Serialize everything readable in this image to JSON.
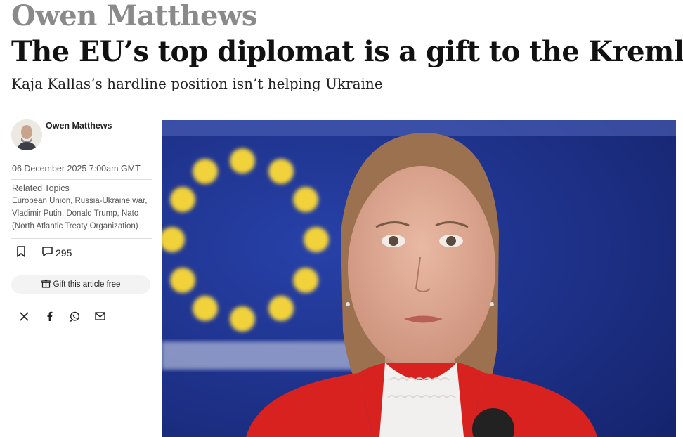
{
  "article": {
    "kicker": "Owen Matthews",
    "headline": "The EU’s top diplomat is a gift to the Kremlin",
    "standfirst": "Kaja Kallas’s hardline position isn’t helping Ukraine"
  },
  "sidebar": {
    "author_name": "Owen Matthews",
    "date": "06 December 2025 7:00am GMT",
    "related_topics_title": "Related Topics",
    "related_topics": "European Union, Russia-Ukraine war, Vladimir Putin, Donald Trump, Nato (North Atlantic Treaty Organization)",
    "comment_count": "295",
    "gift_label": "Gift this article free"
  },
  "icons": {
    "bookmark": "bookmark-icon",
    "comment": "comment-icon",
    "gift": "gift-icon",
    "share": [
      "x-icon",
      "facebook-icon",
      "whatsapp-icon",
      "email-icon"
    ]
  },
  "colors": {
    "kicker": "#8a8a8a",
    "eu_blue": "#1f2f8f",
    "eu_star": "#f2d23a",
    "jacket_red": "#d8221f"
  }
}
